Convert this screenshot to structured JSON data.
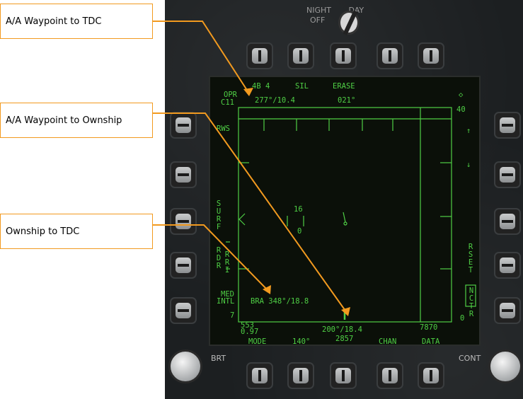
{
  "callouts": {
    "wp_to_tdc": "A/A Waypoint to TDC",
    "wp_to_ownship": "A/A Waypoint to Ownship",
    "ownship_to_tdc": "Ownship to TDC"
  },
  "bezel": {
    "night_label": "NIGHT",
    "day_label": "DAY",
    "off_label": "OFF",
    "brt_label": "BRT",
    "cont_label": "CONT"
  },
  "display": {
    "top_row": [
      "4B 4",
      "SIL",
      "ERASE"
    ],
    "opr": "OPR",
    "c11": "C11",
    "wp_tdc_readout": "277°/10.4",
    "heading_top": "021°",
    "range_scale": "40",
    "rws": "RWS",
    "surf": "SURF",
    "rdr": "RDR",
    "rdr_sub": "RRI",
    "med": "MED",
    "intl": "INTL",
    "left_bottom_num": "7",
    "bra_readout": "BRA 348°/18.8",
    "wp_ownship_readout": "200°/18.4",
    "altitude_top": "553",
    "altitude_bot": "0.97",
    "right_bottom_num": "7870",
    "zero_right": "0",
    "tdc_top": "16",
    "tdc_bot": "0",
    "rset": "RSET",
    "nctr": "NCTR",
    "bottom_row": [
      "MODE",
      "140°",
      "2857",
      "CHAN",
      "DATA"
    ],
    "up_arrow": "↑",
    "down_arrow": "↓",
    "diamond": "◇"
  },
  "colors": {
    "callout_border": "#f29a1f",
    "leader_line": "#f29a1f",
    "display_green": "#4fcf45"
  }
}
